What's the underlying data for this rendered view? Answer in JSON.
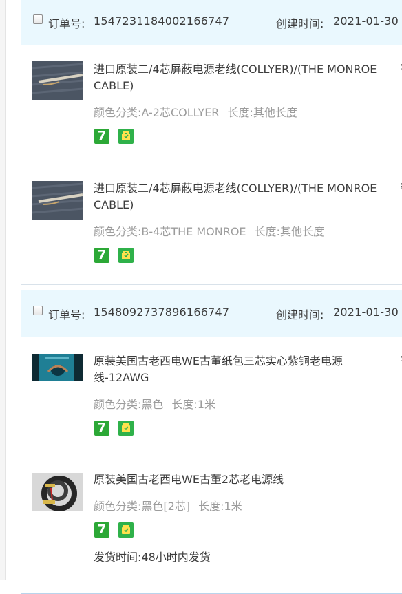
{
  "orders": [
    {
      "order_label": "订单号:",
      "order_no": "1547231184002166747",
      "created_label": "创建时间:",
      "created_date": "2021-01-30",
      "items": [
        {
          "title": "进口原装二/4芯屏蔽电源老线(COLLYER)/(THE MONROE CABLE)",
          "sku_color_label": "颜色分类:",
          "sku_color": "A-2芯COLLYER",
          "sku_len_label": "长度:",
          "sku_len": "其他长度",
          "badge7": "7",
          "price": "¥"
        },
        {
          "title": "进口原装二/4芯屏蔽电源老线(COLLYER)/(THE MONROE CABLE)",
          "sku_color_label": "颜色分类:",
          "sku_color": "B-4芯THE MONROE",
          "sku_len_label": "长度:",
          "sku_len": "其他长度",
          "badge7": "7",
          "price": "¥"
        }
      ]
    },
    {
      "order_label": "订单号:",
      "order_no": "1548092737896166747",
      "created_label": "创建时间:",
      "created_date": "2021-01-30",
      "items": [
        {
          "title": "原装美国古老西电WE古董纸包三芯实心紫铜老电源线-12AWG",
          "sku_color_label": "颜色分类:",
          "sku_color": "黑色",
          "sku_len_label": "长度:",
          "sku_len": "1米",
          "badge7": "7",
          "price": "¥"
        },
        {
          "title": "原装美国古老西电WE古董2芯老电源线",
          "sku_color_label": "颜色分类:",
          "sku_color": "黑色[2芯]",
          "sku_len_label": "长度:",
          "sku_len": "1米",
          "badge7": "7",
          "price": "¥",
          "ship_label": "发货时间:",
          "ship_value": "48小时内发货"
        }
      ]
    }
  ]
}
